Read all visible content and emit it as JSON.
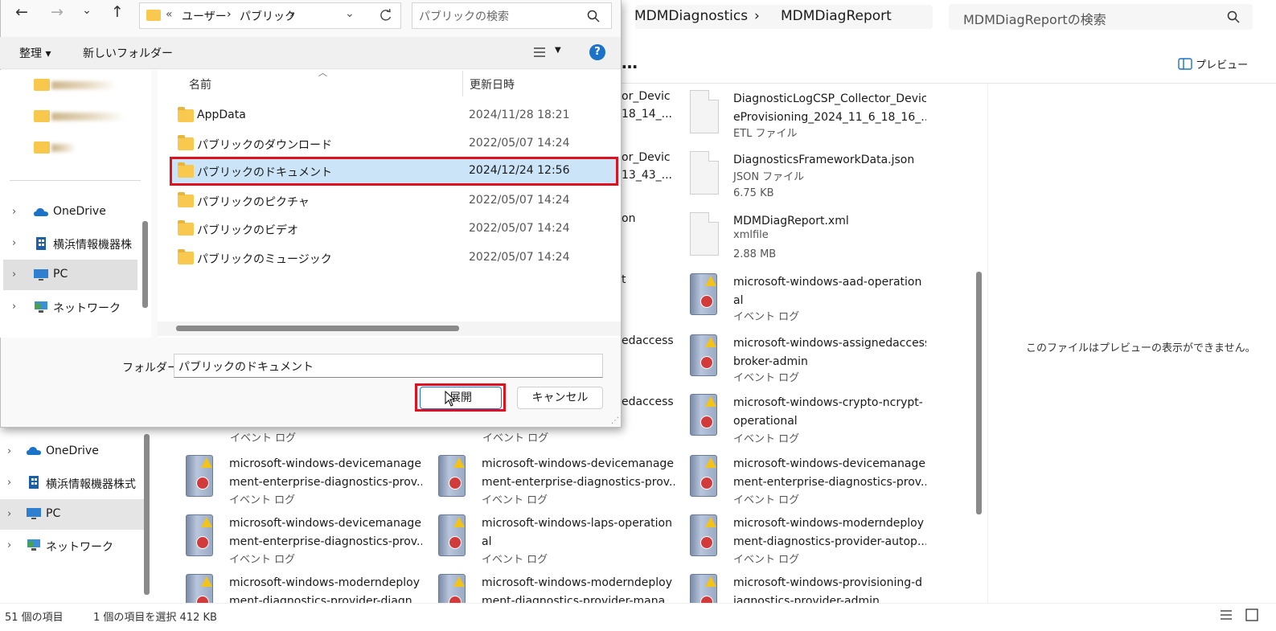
{
  "bg_explorer": {
    "breadcrumb": [
      "MDMDiagnostics",
      "MDMDiagReport"
    ],
    "search_placeholder": "MDMDiagReportの検索",
    "more_label": "…",
    "preview_label": "プレビュー",
    "preview_message": "このファイルはプレビューの表示ができません。",
    "nav": [
      {
        "label": "OneDrive",
        "icon": "cloud-icon"
      },
      {
        "label": "横浜情報機器株式",
        "icon": "building-icon"
      },
      {
        "label": "PC",
        "icon": "pc-icon"
      },
      {
        "label": "ネットワーク",
        "icon": "network-icon"
      }
    ],
    "partial_col1": [
      "or_Devic",
      "18_14_...",
      "or_Devic",
      "13_43_...",
      "on",
      "t",
      "edaccess",
      "edaccess"
    ],
    "partial_col0": [
      "イベント ログ"
    ],
    "partial_col1b": [
      "イベント ログ"
    ],
    "files_col3": [
      {
        "name": [
          "DiagnosticLogCSP_Collector_Devic",
          "eProvisioning_2024_11_6_18_16_..."
        ],
        "sub": [
          "ETL ファイル"
        ],
        "icon": "doc-icon"
      },
      {
        "name": [
          "DiagnosticsFrameworkData.json"
        ],
        "sub": [
          "JSON ファイル",
          "6.75 KB"
        ],
        "icon": "doc-icon"
      },
      {
        "name": [
          "MDMDiagReport.xml"
        ],
        "sub": [
          "xmlfile",
          "2.88 MB"
        ],
        "icon": "doc-icon"
      },
      {
        "name": [
          "microsoft-windows-aad-operation",
          "al"
        ],
        "sub": [
          "イベント ログ"
        ],
        "icon": "event-log-icon"
      },
      {
        "name": [
          "microsoft-windows-assignedaccess",
          "broker-admin"
        ],
        "sub": [
          "イベント ログ"
        ],
        "icon": "event-log-icon"
      },
      {
        "name": [
          "microsoft-windows-crypto-ncrypt-",
          "operational"
        ],
        "sub": [
          "イベント ログ"
        ],
        "icon": "event-log-icon"
      },
      {
        "name": [
          "microsoft-windows-devicemanage",
          "ment-enterprise-diagnostics-prov..."
        ],
        "sub": [
          "イベント ログ"
        ],
        "icon": "event-log-icon"
      },
      {
        "name": [
          "microsoft-windows-moderndeploy",
          "ment-diagnostics-provider-autop..."
        ],
        "sub": [
          "イベント ログ"
        ],
        "icon": "event-log-icon"
      },
      {
        "name": [
          "microsoft-windows-provisioning-d",
          "iagnostics-provider-admin"
        ],
        "sub": [],
        "icon": "event-log-icon"
      }
    ],
    "files_col1": [
      {
        "name": [
          "microsoft-windows-devicemanage",
          "ment-enterprise-diagnostics-prov..."
        ],
        "sub": [
          "イベント ログ"
        ]
      },
      {
        "name": [
          "microsoft-windows-devicemanage",
          "ment-enterprise-diagnostics-prov..."
        ],
        "sub": [
          "イベント ログ"
        ]
      },
      {
        "name": [
          "microsoft-windows-moderndeploy",
          "ment-diagnostics-provider-diagn..."
        ],
        "sub": []
      }
    ],
    "files_col2": [
      {
        "name": [
          "microsoft-windows-devicemanage",
          "ment-enterprise-diagnostics-prov..."
        ],
        "sub": [
          "イベント ログ"
        ]
      },
      {
        "name": [
          "microsoft-windows-laps-operation",
          "al"
        ],
        "sub": [
          "イベント ログ"
        ]
      },
      {
        "name": [
          "microsoft-windows-moderndeploy",
          "ment-diagnostics-provider-mana..."
        ],
        "sub": []
      }
    ],
    "status": {
      "count": "51 個の項目",
      "selected": "1 個の項目を選択  412 KB"
    }
  },
  "dialog": {
    "address": [
      "«",
      "ユーザー",
      "パブリック"
    ],
    "search_placeholder": "パブリックの検索",
    "toolbar": {
      "organize": "整理 ▾",
      "new_folder": "新しいフォルダー",
      "help": "?"
    },
    "nav": [
      {
        "label": "OneDrive",
        "icon": "cloud-icon"
      },
      {
        "label": "横浜情報機器株",
        "icon": "building-icon"
      },
      {
        "label": "PC",
        "icon": "pc-icon"
      },
      {
        "label": "ネットワーク",
        "icon": "network-icon"
      }
    ],
    "columns": {
      "name": "名前",
      "date": "更新日時"
    },
    "rows": [
      {
        "name": "AppData",
        "date": "2024/11/28 18:21",
        "selected": false
      },
      {
        "name": "パブリックのダウンロード",
        "date": "2022/05/07 14:24",
        "selected": false
      },
      {
        "name": "パブリックのドキュメント",
        "date": "2024/12/24 12:56",
        "selected": true
      },
      {
        "name": "パブリックのピクチャ",
        "date": "2022/05/07 14:24",
        "selected": false
      },
      {
        "name": "パブリックのビデオ",
        "date": "2022/05/07 14:24",
        "selected": false
      },
      {
        "name": "パブリックのミュージック",
        "date": "2022/05/07 14:24",
        "selected": false
      }
    ],
    "folder_label": "フォルダー:",
    "folder_value": "パブリックのドキュメント",
    "open_label": "展開",
    "cancel_label": "キャンセル"
  },
  "colors": {
    "highlight": "#e0101e",
    "selection": "#cce4f7",
    "accent": "#1a73c8"
  }
}
